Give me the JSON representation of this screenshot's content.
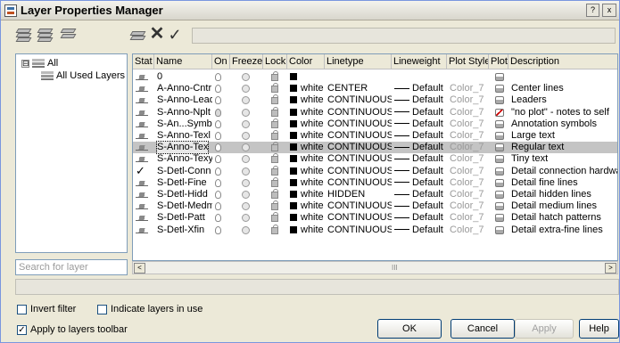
{
  "window": {
    "title": "Layer Properties Manager",
    "help_button": "?",
    "close_button": "x"
  },
  "toolbar": {
    "icons": [
      "new-property-filter-icon",
      "new-group-filter-icon",
      "layer-states-manager-icon",
      "new-layer-icon",
      "delete-layer-icon",
      "set-current-icon"
    ],
    "status_text": ""
  },
  "tree": {
    "root_label": "All",
    "child_label": "All Used Layers",
    "collapse_glyph": "⊟"
  },
  "search": {
    "placeholder": "Search for layer"
  },
  "grid": {
    "columns": [
      "Stat",
      "Name",
      "On",
      "Freeze",
      "Lock",
      "Color",
      "Linetype",
      "Lineweight",
      "Plot Style",
      "Plot",
      "Description"
    ],
    "rows": [
      {
        "status": "arrow",
        "name": "0",
        "on": true,
        "color": "",
        "linetype": "",
        "lineweight": "",
        "plot_style": "",
        "plot": true,
        "description": ""
      },
      {
        "status": "arrow",
        "name": "A-Anno-Cntr",
        "on": true,
        "color": "white",
        "linetype": "CENTER",
        "lineweight": "Default",
        "plot_style": "Color_7",
        "plot": true,
        "description": "Center lines"
      },
      {
        "status": "arrow",
        "name": "S-Anno-Lead",
        "on": true,
        "color": "white",
        "linetype": "CONTINUOUS",
        "lineweight": "Default",
        "plot_style": "Color_7",
        "plot": true,
        "description": "Leaders"
      },
      {
        "status": "arrow",
        "name": "S-Anno-Nplt",
        "on": false,
        "color": "white",
        "linetype": "CONTINUOUS",
        "lineweight": "Default",
        "plot_style": "Color_7",
        "plot": false,
        "description": "\"no plot\" - notes to self"
      },
      {
        "status": "arrow",
        "name": "S-An...Symb",
        "on": true,
        "color": "white",
        "linetype": "CONTINUOUS",
        "lineweight": "Default",
        "plot_style": "Color_7",
        "plot": true,
        "description": "Annotation symbols"
      },
      {
        "status": "arrow",
        "name": "S-Anno-Texl",
        "on": true,
        "color": "white",
        "linetype": "CONTINUOUS",
        "lineweight": "Default",
        "plot_style": "Color_7",
        "plot": true,
        "description": "Large text"
      },
      {
        "status": "arrow",
        "name": "S-Anno-Text",
        "on": true,
        "color": "white",
        "linetype": "CONTINUOUS",
        "lineweight": "Default",
        "plot_style": "Color_7",
        "plot": true,
        "description": "Regular text",
        "selected": true
      },
      {
        "status": "arrow",
        "name": "S-Anno-Texy",
        "on": true,
        "color": "white",
        "linetype": "CONTINUOUS",
        "lineweight": "Default",
        "plot_style": "Color_7",
        "plot": true,
        "description": "Tiny text"
      },
      {
        "status": "current",
        "name": "S-Detl-Conn",
        "on": true,
        "color": "white",
        "linetype": "CONTINUOUS",
        "lineweight": "Default",
        "plot_style": "Color_7",
        "plot": true,
        "description": "Detail connection hardware"
      },
      {
        "status": "arrow",
        "name": "S-Detl-Fine",
        "on": true,
        "color": "white",
        "linetype": "CONTINUOUS",
        "lineweight": "Default",
        "plot_style": "Color_7",
        "plot": true,
        "description": "Detail fine lines"
      },
      {
        "status": "arrow",
        "name": "S-Detl-Hidd",
        "on": true,
        "color": "white",
        "linetype": "HIDDEN",
        "lineweight": "Default",
        "plot_style": "Color_7",
        "plot": true,
        "description": "Detail hidden lines"
      },
      {
        "status": "arrow",
        "name": "S-Detl-Medm",
        "on": true,
        "color": "white",
        "linetype": "CONTINUOUS",
        "lineweight": "Default",
        "plot_style": "Color_7",
        "plot": true,
        "description": "Detail medium lines"
      },
      {
        "status": "arrow",
        "name": "S-Detl-Patt",
        "on": true,
        "color": "white",
        "linetype": "CONTINUOUS",
        "lineweight": "Default",
        "plot_style": "Color_7",
        "plot": true,
        "description": "Detail hatch patterns"
      },
      {
        "status": "arrow",
        "name": "S-Detl-Xfin",
        "on": true,
        "color": "white",
        "linetype": "CONTINUOUS",
        "lineweight": "Default",
        "plot_style": "Color_7",
        "plot": true,
        "description": "Detail extra-fine lines"
      }
    ]
  },
  "scroll": {
    "left": "<",
    "right": ">",
    "grip": "III"
  },
  "options": {
    "invert_filter": {
      "label": "Invert filter",
      "checked": false
    },
    "indicate_in_use": {
      "label": "Indicate layers in use",
      "checked": false
    },
    "apply_toolbar": {
      "label": "Apply to layers toolbar",
      "checked": true
    }
  },
  "buttons": {
    "ok": "OK",
    "cancel": "Cancel",
    "apply": "Apply",
    "help": "Help"
  },
  "colors": {
    "selection": "#c4c4c4",
    "grid_border": "#7f9db9",
    "dialog_bg": "#ece9d8"
  }
}
